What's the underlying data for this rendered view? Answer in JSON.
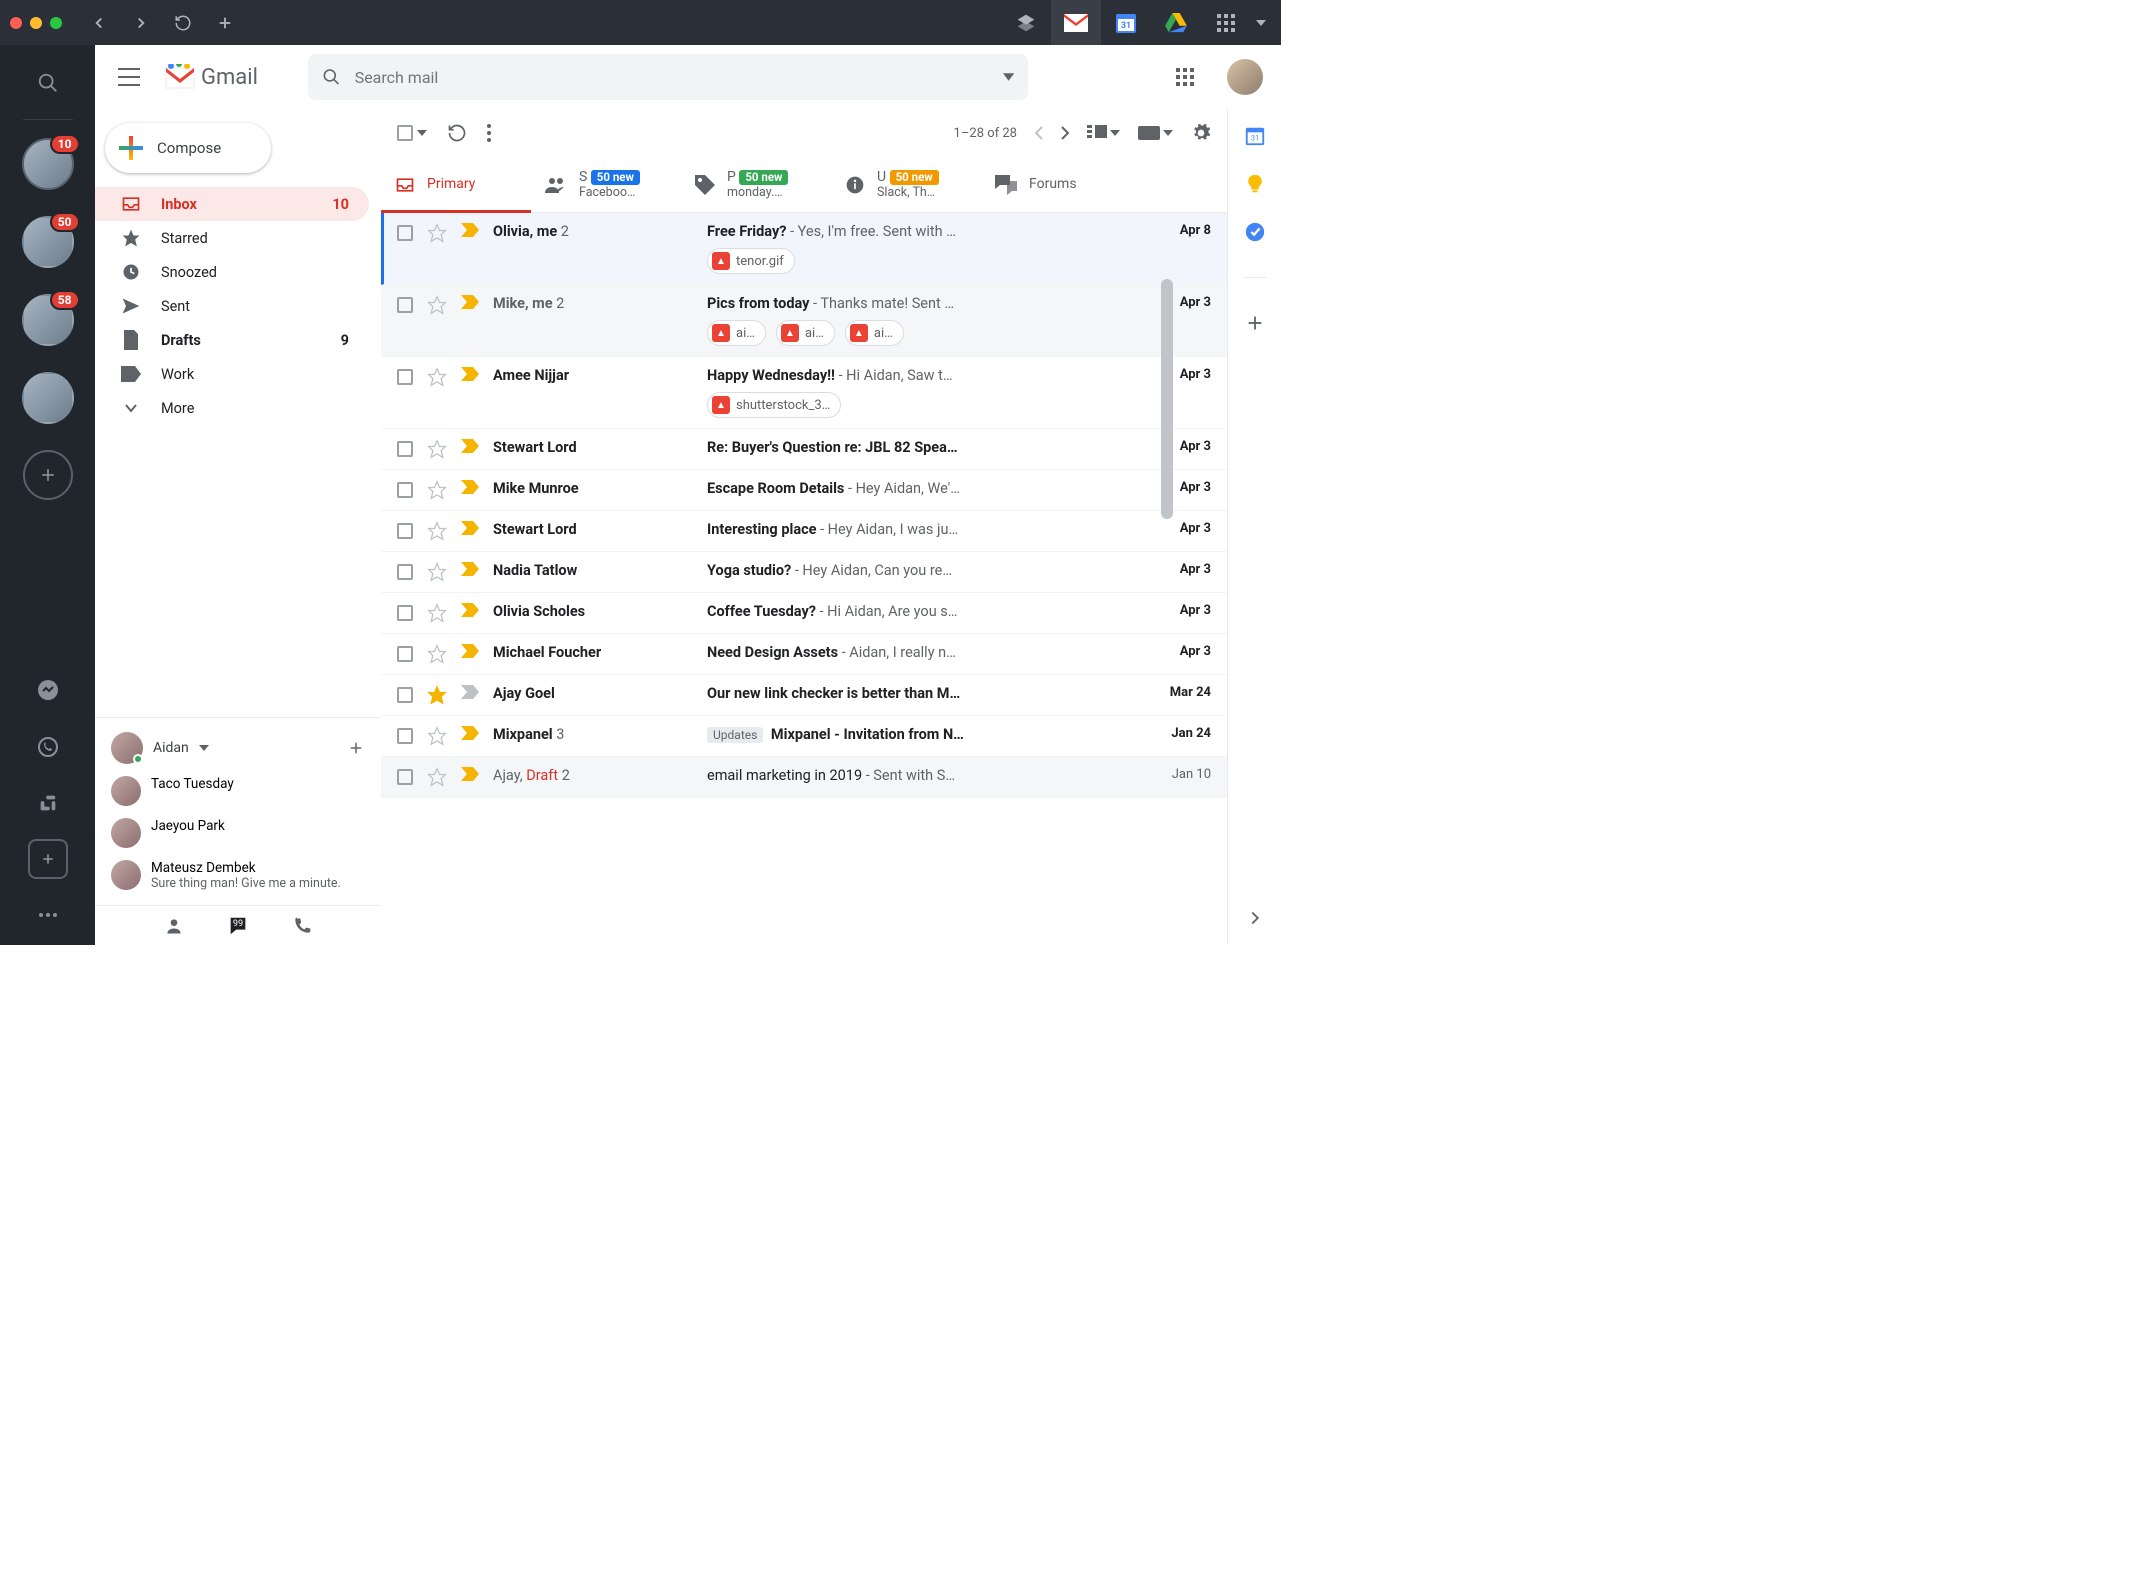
{
  "titlebar": {
    "traffic": [
      "#ff5f57",
      "#febc2e",
      "#28c840"
    ]
  },
  "dock": {
    "avatars": [
      {
        "badge": "10",
        "active": true
      },
      {
        "badge": "50"
      },
      {
        "badge": "58"
      },
      {
        "badge": null
      }
    ]
  },
  "header": {
    "logo": "Gmail",
    "search_placeholder": "Search mail"
  },
  "compose": {
    "label": "Compose"
  },
  "nav": [
    {
      "icon": "inbox",
      "label": "Inbox",
      "count": "10",
      "active": true,
      "bold": true
    },
    {
      "icon": "star",
      "label": "Starred"
    },
    {
      "icon": "clock",
      "label": "Snoozed"
    },
    {
      "icon": "send",
      "label": "Sent"
    },
    {
      "icon": "file",
      "label": "Drafts",
      "count": "9",
      "bold": true
    },
    {
      "icon": "label",
      "label": "Work"
    },
    {
      "icon": "chevron",
      "label": "More"
    }
  ],
  "hangouts": {
    "me": "Aidan",
    "contacts": [
      {
        "name": "Taco Tuesday"
      },
      {
        "name": "Jaeyou Park"
      },
      {
        "name": "Mateusz Dembek",
        "sub": "Sure thing man! Give me a minute."
      }
    ]
  },
  "toolbar": {
    "range": "1–28 of 28"
  },
  "tabs": [
    {
      "icon": "inbox",
      "label": "Primary",
      "active": true
    },
    {
      "icon": "people",
      "label": "S",
      "pill": "50 new",
      "pillColor": "#1a73e8",
      "sub": "Faceboo…"
    },
    {
      "icon": "tag",
      "label": "P",
      "pill": "50 new",
      "pillColor": "#34a853",
      "sub": "monday.…"
    },
    {
      "icon": "info",
      "label": "U",
      "pill": "50 new",
      "pillColor": "#f29900",
      "sub": "Slack, Th…"
    },
    {
      "icon": "forum",
      "label": "Forums"
    }
  ],
  "messages": [
    {
      "sel": true,
      "unread": true,
      "imp": true,
      "from": "Olivia, me",
      "fc": "2",
      "subj": "Free Friday?",
      "snip": " - Yes, I'm free. Sent with …",
      "date": "Apr 8",
      "att": [
        "tenor.gif"
      ]
    },
    {
      "unread": true,
      "read": true,
      "imp": true,
      "from": "Mike, me",
      "fc": "2",
      "subj": "Pics from today",
      "snip": " - Thanks mate! Sent …",
      "date": "Apr 3",
      "att": [
        "ai…",
        "ai…",
        "ai…"
      ]
    },
    {
      "unread": true,
      "imp": true,
      "from": "Amee Nijjar",
      "subj": "Happy Wednesday!!",
      "snip": " - Hi Aidan, Saw t…",
      "date": "Apr 3",
      "att": [
        "shutterstock_3…"
      ]
    },
    {
      "unread": true,
      "imp": true,
      "from": "Stewart Lord",
      "subj": "Re: Buyer's Question re: JBL 82 Spea…",
      "date": "Apr 3"
    },
    {
      "unread": true,
      "imp": true,
      "from": "Mike Munroe",
      "subj": "Escape Room Details",
      "snip": " - Hey Aidan, We'…",
      "date": "Apr 3"
    },
    {
      "unread": true,
      "imp": true,
      "from": "Stewart Lord",
      "subj": "Interesting place",
      "snip": " - Hey Aidan, I was ju…",
      "date": "Apr 3"
    },
    {
      "unread": true,
      "imp": true,
      "from": "Nadia Tatlow",
      "subj": "Yoga studio?",
      "snip": " - Hey Aidan, Can you re…",
      "date": "Apr 3"
    },
    {
      "unread": true,
      "imp": true,
      "from": "Olivia Scholes",
      "subj": "Coffee Tuesday?",
      "snip": " - Hi Aidan, Are you s…",
      "date": "Apr 3"
    },
    {
      "unread": true,
      "imp": true,
      "from": "Michael Foucher",
      "subj": "Need Design Assets",
      "snip": " - Aidan, I really n…",
      "date": "Apr 3"
    },
    {
      "unread": true,
      "starred": true,
      "imp": false,
      "from": "Ajay Goel",
      "subj": "Our new link checker is better than M…",
      "date": "Mar 24"
    },
    {
      "unread": true,
      "imp": true,
      "from": "Mixpanel",
      "fc": "3",
      "cat": "Updates",
      "subj": "Mixpanel - Invitation from N…",
      "date": "Jan 24"
    },
    {
      "read": true,
      "imp": true,
      "from": "Ajay, ",
      "draft": "Draft",
      "fc": "2",
      "subj": "email marketing in 2019",
      "snip": " - Sent with S…",
      "date": "Jan 10"
    }
  ]
}
